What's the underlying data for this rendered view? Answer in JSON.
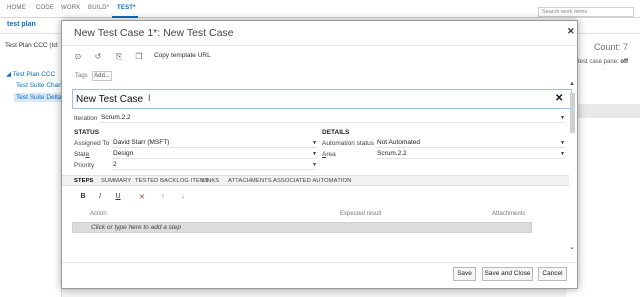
{
  "topnav": {
    "items": [
      "HOME",
      "CODE",
      "WORK",
      "BUILD",
      "TEST"
    ],
    "build_suffix": "*",
    "test_suffix": "*",
    "search_placeholder": "Search work items"
  },
  "subnav": {
    "tab": "test plan"
  },
  "left_pane": {
    "plan_selector": "Test Plan CCC (Id: 5)",
    "tree": [
      "Test Plan CCC",
      "Test Suite Charlie",
      "Test Suite Delta"
    ]
  },
  "right_pane": {
    "count": "Count: 7",
    "pane_label": "test case pane:",
    "pane_value": "off"
  },
  "dialog": {
    "title": "New Test Case 1*: New Test Case",
    "toolbar": {
      "copy_template_url": "Copy template URL"
    },
    "tags": {
      "label": "Tags",
      "add": "Add..."
    },
    "title_field": {
      "value": "New Test Case"
    },
    "iteration": {
      "label": "Iteration",
      "value": "Scrum.2.2"
    },
    "status": {
      "header": "STATUS",
      "assigned_to": {
        "label": "Assigned To",
        "value": "David Starr (MSFT)"
      },
      "state": {
        "label_pre": "Stat",
        "label_u": "e",
        "value": "Design"
      },
      "priority": {
        "label": "Priority",
        "value": "2"
      }
    },
    "details": {
      "header": "DETAILS",
      "automation_status": {
        "label": "Automation status",
        "value": "Not Automated"
      },
      "area": {
        "label_u": "A",
        "label_post": "rea",
        "value": "Scrum.2.2"
      }
    },
    "tabs": [
      "STEPS",
      "SUMMARY",
      "TESTED BACKLOG ITEMS",
      "LINKS",
      "ATTACHMENTS",
      "ASSOCIATED AUTOMATION"
    ],
    "format_buttons": [
      "B",
      "I",
      "U"
    ],
    "steps": {
      "col_action": "Action",
      "col_expected": "Expected result",
      "col_attachments": "Attachments",
      "placeholder_row": "Click or type here to add a step"
    },
    "buttons": {
      "save": "Save",
      "save_and_close": "Save and Close",
      "cancel": "Cancel"
    }
  }
}
